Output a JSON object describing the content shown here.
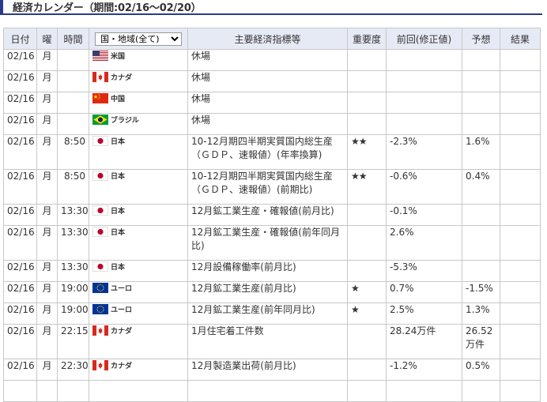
{
  "page_title": "経済カレンダー（期間:02/16〜02/20）",
  "columns": {
    "date": "日付",
    "dow": "曜",
    "time": "時間",
    "region_select": "国・地域(全て)",
    "indicator": "主要経済指標等",
    "importance": "重要度",
    "previous": "前回(修正値)",
    "forecast": "予想",
    "result": "結果"
  },
  "rows": [
    {
      "date": "02/16",
      "dow": "月",
      "time": "",
      "flag": "us",
      "country": "米国",
      "indicator": "休場",
      "importance": "",
      "previous": "",
      "forecast": "",
      "result": ""
    },
    {
      "date": "02/16",
      "dow": "月",
      "time": "",
      "flag": "ca",
      "country": "カナダ",
      "indicator": "休場",
      "importance": "",
      "previous": "",
      "forecast": "",
      "result": ""
    },
    {
      "date": "02/16",
      "dow": "月",
      "time": "",
      "flag": "cn",
      "country": "中国",
      "indicator": "休場",
      "importance": "",
      "previous": "",
      "forecast": "",
      "result": ""
    },
    {
      "date": "02/16",
      "dow": "月",
      "time": "",
      "flag": "br",
      "country": "ブラジル",
      "indicator": "休場",
      "importance": "",
      "previous": "",
      "forecast": "",
      "result": ""
    },
    {
      "date": "02/16",
      "dow": "月",
      "time": "8:50",
      "flag": "jp",
      "country": "日本",
      "indicator": "10-12月期四半期実質国内総生産（ＧＤＰ、速報値）(年率換算)",
      "importance": "★★",
      "previous": "-2.3%",
      "forecast": "1.6%",
      "result": ""
    },
    {
      "date": "02/16",
      "dow": "月",
      "time": "8:50",
      "flag": "jp",
      "country": "日本",
      "indicator": "10-12月期四半期実質国内総生産（ＧＤＰ、速報値）(前期比)",
      "importance": "★★",
      "previous": "-0.6%",
      "forecast": "0.4%",
      "result": ""
    },
    {
      "date": "02/16",
      "dow": "月",
      "time": "13:30",
      "flag": "jp",
      "country": "日本",
      "indicator": "12月鉱工業生産・確報値(前月比)",
      "importance": "",
      "previous": "-0.1%",
      "forecast": "",
      "result": ""
    },
    {
      "date": "02/16",
      "dow": "月",
      "time": "13:30",
      "flag": "jp",
      "country": "日本",
      "indicator": "12月鉱工業生産・確報値(前年同月比)",
      "importance": "",
      "previous": "2.6%",
      "forecast": "",
      "result": ""
    },
    {
      "date": "02/16",
      "dow": "月",
      "time": "13:30",
      "flag": "jp",
      "country": "日本",
      "indicator": "12月設備稼働率(前月比)",
      "importance": "",
      "previous": "-5.3%",
      "forecast": "",
      "result": ""
    },
    {
      "date": "02/16",
      "dow": "月",
      "time": "19:00",
      "flag": "eu",
      "country": "ユーロ",
      "indicator": "12月鉱工業生産(前月比)",
      "importance": "★",
      "previous": "0.7%",
      "forecast": "-1.5%",
      "result": ""
    },
    {
      "date": "02/16",
      "dow": "月",
      "time": "19:00",
      "flag": "eu",
      "country": "ユーロ",
      "indicator": "12月鉱工業生産(前年同月比)",
      "importance": "★",
      "previous": "2.5%",
      "forecast": "1.3%",
      "result": ""
    },
    {
      "date": "02/16",
      "dow": "月",
      "time": "22:15",
      "flag": "ca",
      "country": "カナダ",
      "indicator": "1月住宅着工件数",
      "importance": "",
      "previous": "28.24万件",
      "forecast": "26.52万件",
      "result": ""
    },
    {
      "date": "02/16",
      "dow": "月",
      "time": "22:30",
      "flag": "ca",
      "country": "カナダ",
      "indicator": "12月製造業出荷(前月比)",
      "importance": "",
      "previous": "-1.2%",
      "forecast": "0.5%",
      "result": ""
    },
    {
      "date": "",
      "dow": "",
      "time": "",
      "flag": "",
      "country": "",
      "indicator": "",
      "importance": "",
      "previous": "",
      "forecast": "",
      "result": ""
    }
  ],
  "row_heights": [
    "r1",
    "r1",
    "r1",
    "r1",
    "r2",
    "r2",
    "r1",
    "r2",
    "r1",
    "r1",
    "r1",
    "r2",
    "r1",
    "r1"
  ],
  "colors": {
    "accent": "#2b3a8c",
    "header_bg": "#e6eaf5",
    "border": "#c8c8c8"
  }
}
